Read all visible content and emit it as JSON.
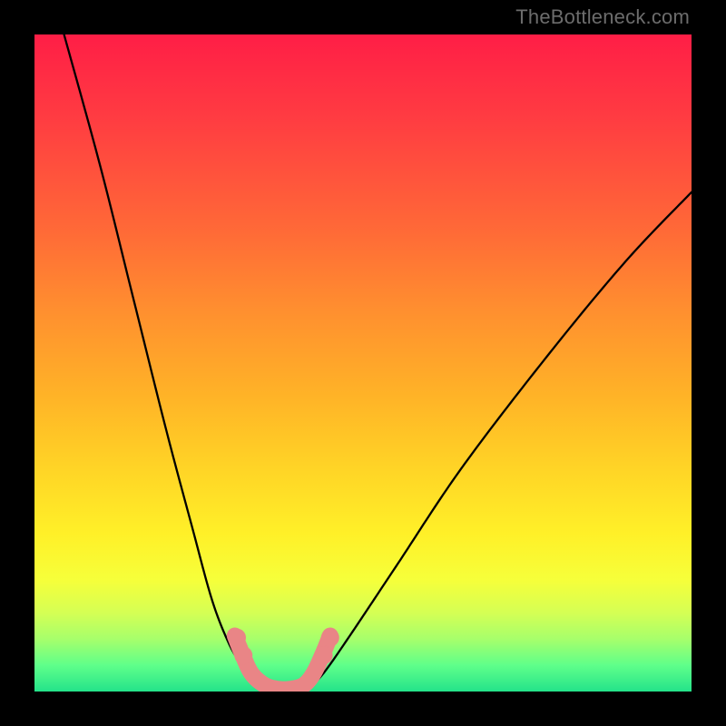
{
  "watermark": "TheBottleneck.com",
  "chart_data": {
    "type": "line",
    "title": "",
    "xlabel": "",
    "ylabel": "",
    "xlim": [
      0,
      1
    ],
    "ylim": [
      0,
      1
    ],
    "series": [
      {
        "name": "left-curve",
        "x": [
          0.045,
          0.1,
          0.15,
          0.2,
          0.24,
          0.27,
          0.295,
          0.315,
          0.33,
          0.345
        ],
        "y": [
          1.0,
          0.8,
          0.6,
          0.4,
          0.25,
          0.14,
          0.075,
          0.04,
          0.018,
          0.003
        ]
      },
      {
        "name": "right-curve",
        "x": [
          0.415,
          0.44,
          0.48,
          0.55,
          0.65,
          0.78,
          0.9,
          1.0
        ],
        "y": [
          0.003,
          0.028,
          0.085,
          0.19,
          0.34,
          0.51,
          0.655,
          0.76
        ]
      },
      {
        "name": "trough-marker",
        "x": [
          0.305,
          0.315,
          0.33,
          0.35,
          0.37,
          0.39,
          0.41,
          0.425,
          0.44,
          0.45
        ],
        "y": [
          0.085,
          0.06,
          0.028,
          0.01,
          0.004,
          0.004,
          0.01,
          0.028,
          0.06,
          0.085
        ]
      }
    ],
    "marker_dots": [
      {
        "x": 0.308,
        "y": 0.082
      },
      {
        "x": 0.318,
        "y": 0.055
      },
      {
        "x": 0.44,
        "y": 0.055
      },
      {
        "x": 0.45,
        "y": 0.082
      }
    ],
    "colors": {
      "curve": "#000000",
      "marker": "#e98586"
    }
  }
}
